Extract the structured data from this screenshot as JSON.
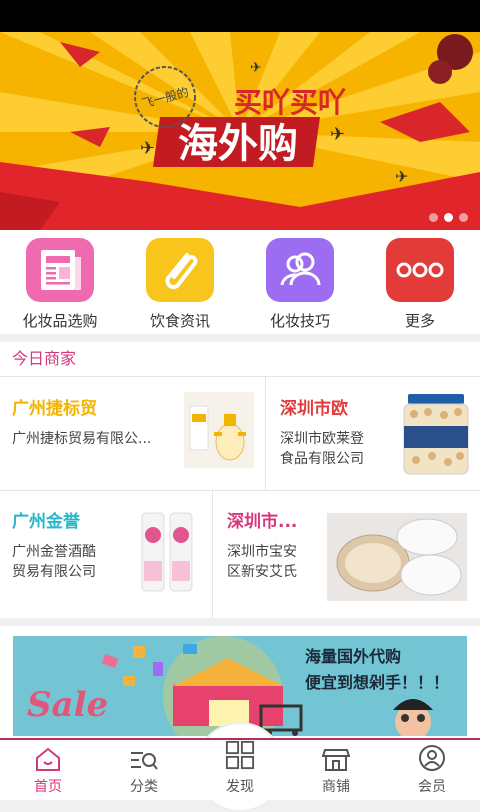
{
  "banner": {
    "headline": "海外购",
    "sub": "买吖买吖",
    "stamp": "飞一般的",
    "colors": {
      "bg": "#f5b800",
      "red": "#e02a2a"
    },
    "slide_count": 3,
    "active_slide": 2
  },
  "quick_menu": [
    {
      "label": "化妆品选购",
      "icon": "newspaper-icon",
      "color": "#f06ab0"
    },
    {
      "label": "饮食资讯",
      "icon": "paperclip-icon",
      "color": "#f7c51c"
    },
    {
      "label": "化妆技巧",
      "icon": "users-icon",
      "color": "#9c6cf2"
    },
    {
      "label": "更多",
      "icon": "more-dots-icon",
      "color": "#e33a3a"
    }
  ],
  "merchants": {
    "title": "今日商家",
    "items": [
      {
        "name": "广州捷标贸",
        "desc": "广州捷标贸易有限公...",
        "name_color": "#f3b400"
      },
      {
        "name": "深圳市欧",
        "desc": "深圳市欧莱登食品有限公司",
        "desc_lines": [
          "深圳市欧莱登",
          "食品有限公司"
        ],
        "name_color": "#e23b3b"
      },
      {
        "name": "广州金誉",
        "desc_lines": [
          "广州金誉酒酷",
          "贸易有限公司"
        ],
        "name_color": "#29b6c8"
      },
      {
        "name": "深圳市...",
        "desc_lines": [
          "深圳市宝安",
          "区新安艾氏"
        ],
        "name_color": "#d6377b"
      }
    ]
  },
  "ad": {
    "line1": "海量国外代购",
    "line2": "便宜到想剁手！！！",
    "sale": "Sale"
  },
  "tabs": [
    {
      "label": "首页",
      "icon": "home-icon",
      "active": true
    },
    {
      "label": "分类",
      "icon": "category-search-icon",
      "active": false
    },
    {
      "label": "发现",
      "icon": "grid-icon",
      "active": false
    },
    {
      "label": "商铺",
      "icon": "shop-icon",
      "active": false
    },
    {
      "label": "会员",
      "icon": "user-icon",
      "active": false
    }
  ]
}
